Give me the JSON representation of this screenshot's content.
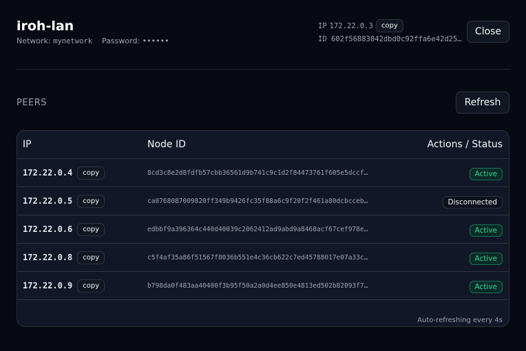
{
  "header": {
    "title": "iroh-lan",
    "network_label": "Network:",
    "network": "mynetwork",
    "password_label": "Password:",
    "password": "••••••",
    "ip_label": "IP",
    "ip": "172.22.0.3",
    "copy": "copy",
    "id_label": "ID",
    "id": "602f56883042dbd0c92ffa6e42d25…",
    "close": "Close"
  },
  "peers": {
    "title": "PEERS",
    "refresh": "Refresh",
    "columns": [
      "IP",
      "Node ID",
      "Actions / Status"
    ],
    "rows": [
      {
        "ip": "172.22.0.4",
        "copy": "copy",
        "node_id": "8cd3c8e2d8fdfb57cbb36561d9b741c9c1d2f84473761f605e5dccf…",
        "status": "Active"
      },
      {
        "ip": "172.22.0.5",
        "copy": "copy",
        "node_id": "ca0768087009820ff349b9426fc35f88a6c9f20f2f461a80dcbcceb…",
        "status": "Disconnected"
      },
      {
        "ip": "172.22.0.6",
        "copy": "copy",
        "node_id": "edbbf9a396364c440d40039c2062412ad9abd9a8468acf67cef978e…",
        "status": "Active"
      },
      {
        "ip": "172.22.0.8",
        "copy": "copy",
        "node_id": "c5f4af35a86f51567f8036b551e4c36cb622c7ed45788017e07a33c…",
        "status": "Active"
      },
      {
        "ip": "172.22.0.9",
        "copy": "copy",
        "node_id": "b798da0f483aa40400f3b95f50a2a0d4ee850e4813ed502b82093f7…",
        "status": "Active"
      }
    ],
    "footer": "Auto-refreshing every 4s"
  }
}
